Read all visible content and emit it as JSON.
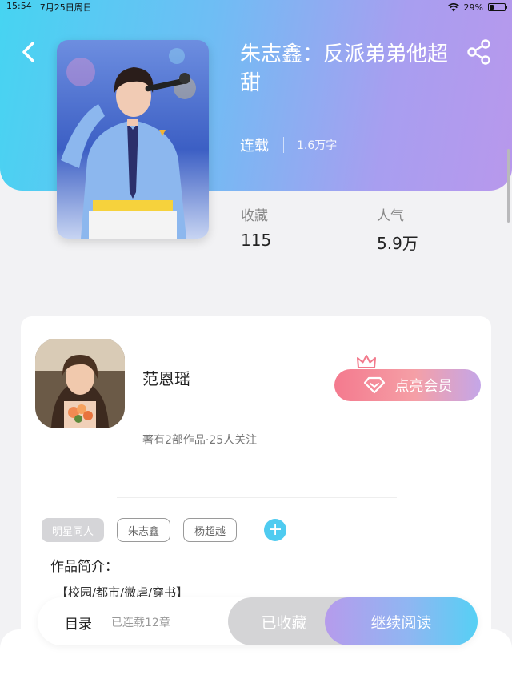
{
  "status_bar": {
    "time": "15:54",
    "date": "7月25日周日",
    "battery": "29%",
    "battery_level": 0.29
  },
  "book": {
    "title": "朱志鑫：反派弟弟他超甜",
    "status": "连载",
    "word_count": "1.6万字"
  },
  "stats": [
    {
      "label": "收藏",
      "value": "115"
    },
    {
      "label": "人气",
      "value": "5.9万"
    }
  ],
  "author": {
    "name": "范恩瑶",
    "info": "著有2部作品·25人关注"
  },
  "vip": {
    "label": "点亮会员"
  },
  "tags": [
    "明星同人",
    "朱志鑫",
    "杨超越"
  ],
  "tag_add_label": "+",
  "intro": {
    "title": "作品简介：",
    "text": "【校园/都市/微虐/穿书】"
  },
  "bottom": {
    "toc_label": "目录",
    "chapter_count": "已连载12章",
    "collected_label": "已收藏",
    "read_label": "继续阅读"
  },
  "colors": {
    "header_start": "#46d4f2",
    "header_end": "#b898ec",
    "vip_start": "#f47a8e",
    "accent": "#4fcbf0"
  },
  "icons": {
    "back": "chevron-left-icon",
    "share": "share-icon",
    "crown": "crown-icon",
    "diamond": "diamond-icon",
    "wifi": "wifi-icon",
    "battery": "battery-icon"
  }
}
